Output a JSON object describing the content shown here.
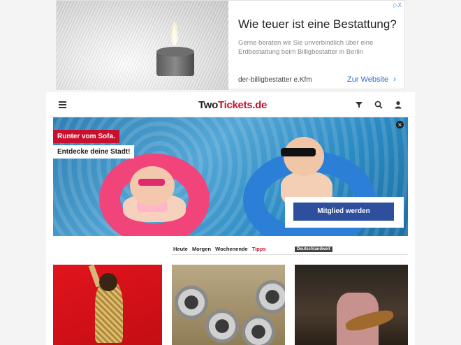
{
  "ad": {
    "adchoices": "▷X",
    "title": "Wie teuer ist eine Bestattung?",
    "description": "Gerne beraten wir Sie unverbindlich über eine Erdbestattung beim Billigbestatter in Berlin",
    "sponsor": "der-billigbestatter e.Kfm",
    "cta": "Zur Website"
  },
  "header": {
    "logo_part1": "Two",
    "logo_part2": "Tickets.de",
    "icons": [
      "menu-icon",
      "filter-icon",
      "search-icon",
      "user-icon"
    ]
  },
  "hero": {
    "tag1": "Runter vom Sofa.",
    "tag2": "Entdecke deine Stadt!",
    "cta": "Mitglied werden",
    "close": "×"
  },
  "day_nav": {
    "items": [
      "Heute",
      "Morgen",
      "Wochenende",
      "Tipps"
    ],
    "active": "Tipps",
    "region": "Deutschlandweit"
  },
  "colors": {
    "brand_red": "#c8102e",
    "cta_blue": "#2d4f9e",
    "ad_link": "#2a6fd1"
  }
}
